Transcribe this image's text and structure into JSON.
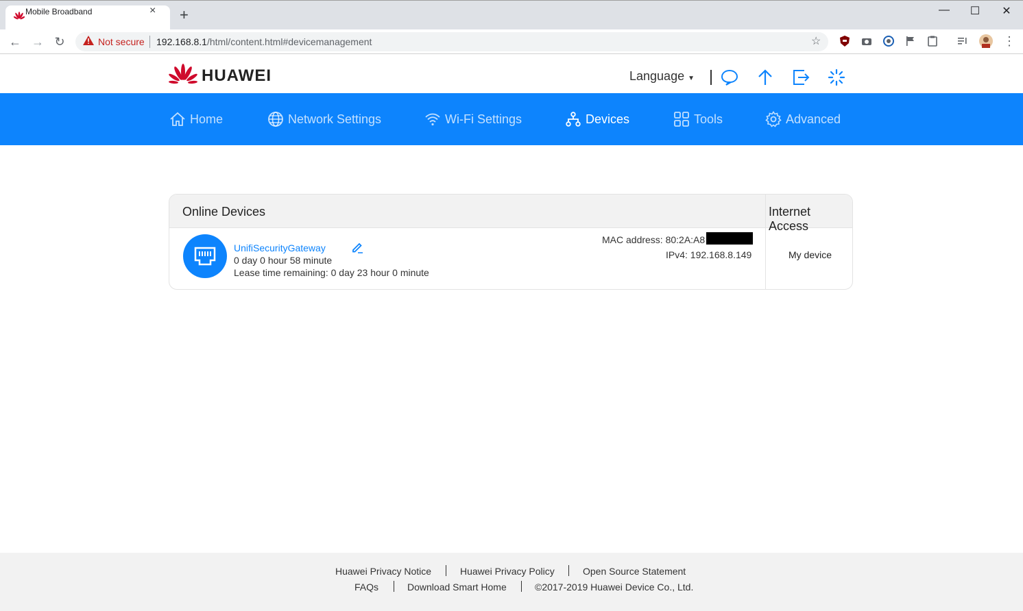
{
  "browser": {
    "tab_title": "Mobile Broadband",
    "tab_close": "×",
    "new_tab": "+",
    "not_secure": "Not secure",
    "url_host": "192.168.8.1",
    "url_path": "/html/content.html#devicemanagement"
  },
  "header": {
    "brand": "HUAWEI",
    "language_label": "Language"
  },
  "nav": {
    "items": [
      {
        "label": "Home",
        "icon": "home-icon"
      },
      {
        "label": "Network Settings",
        "icon": "globe-icon"
      },
      {
        "label": "Wi-Fi Settings",
        "icon": "wifi-icon"
      },
      {
        "label": "Devices",
        "icon": "devices-icon",
        "active": true
      },
      {
        "label": "Tools",
        "icon": "tools-grid-icon"
      },
      {
        "label": "Advanced",
        "icon": "gear-icon"
      }
    ]
  },
  "devices": {
    "col_online": "Online Devices",
    "col_access": "Internet Access",
    "rows": [
      {
        "name": "UnifiSecurityGateway",
        "duration": "0 day 0 hour 58 minute",
        "lease": "Lease time remaining: 0 day 23 hour 0 minute",
        "mac": "MAC address: 80:2A:A8",
        "ipv4": "IPv4: 192.168.8.149",
        "access": "My device"
      }
    ]
  },
  "footer": {
    "privacy_notice": "Huawei Privacy Notice",
    "privacy_policy": "Huawei Privacy Policy",
    "open_source": "Open Source Statement",
    "faqs": "FAQs",
    "download": "Download Smart Home",
    "copyright": "©2017-2019 Huawei Device Co., Ltd."
  },
  "colors": {
    "brand_blue": "#0d84fd",
    "huawei_red": "#cf0a2c"
  }
}
